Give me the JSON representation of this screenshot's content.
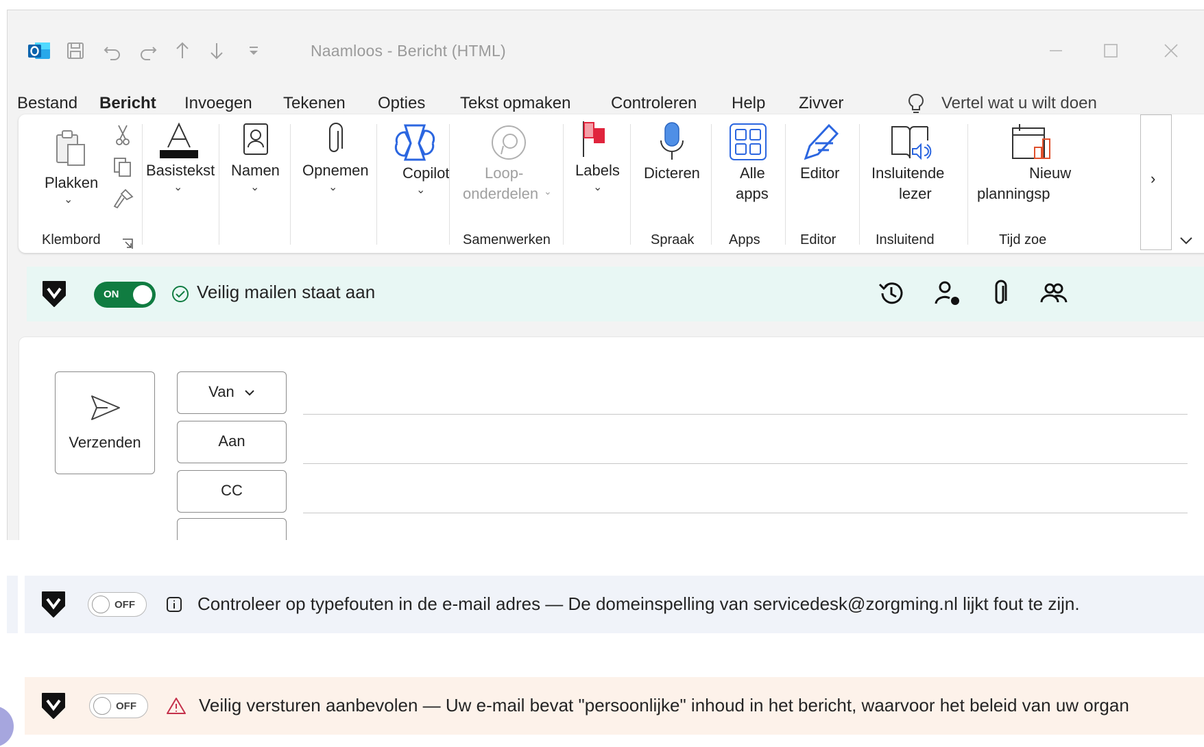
{
  "titlebar": {
    "title": "Naamloos  -  Bericht (HTML)"
  },
  "menu": {
    "items": [
      "Bestand",
      "Bericht",
      "Invoegen",
      "Tekenen",
      "Opties",
      "Tekst opmaken",
      "Controleren",
      "Help",
      "Zivver"
    ],
    "active": "Bericht",
    "tellme_placeholder": "Vertel wat u wilt doen"
  },
  "ribbon": {
    "paste_label": "Plakken",
    "basic_text_label": "Basistekst",
    "names_label": "Namen",
    "include_label": "Opnemen",
    "copilot_label": "Copilot",
    "loop_label_1": "Loop-",
    "loop_label_2": "onderdelen",
    "labels_label": "Labels",
    "dictate_label": "Dicteren",
    "apps_label_1": "Alle",
    "apps_label_2": "apps",
    "editor_label": "Editor",
    "reader_label_1": "Insluitende",
    "reader_label_2": "lezer",
    "schedule_label_1": "Nieuw",
    "schedule_label_2": "planningsp",
    "groups": {
      "clipboard": "Klembord",
      "collaborate": "Samenwerken",
      "speech": "Spraak",
      "apps": "Apps",
      "editor": "Editor",
      "immersive": "Insluitend",
      "time": "Tijd zoe"
    }
  },
  "secure_banner": {
    "toggle_label": "ON",
    "text": "Veilig mailen staat aan"
  },
  "compose": {
    "send_label": "Verzenden",
    "from_label": "Van",
    "to_label": "Aan",
    "cc_label": "CC"
  },
  "warning_banner": {
    "toggle_label": "OFF",
    "text": "Controleer op typefouten in de e-mail adres — De domeinspelling van servicedesk@zorgming.nl lijkt fout te zijn."
  },
  "danger_banner": {
    "toggle_label": "OFF",
    "text": "Veilig versturen aanbevolen — Uw e-mail bevat \"persoonlijke\" inhoud in het bericht, waarvoor het beleid van uw organ"
  },
  "colors": {
    "accent": "#0f6cbd",
    "secure_green": "#107c41",
    "secure_bg": "#e8f7f4",
    "info_bg": "#f0f3f9",
    "warn_bg": "#fdf2ea",
    "warn_icon": "#c4314b"
  }
}
